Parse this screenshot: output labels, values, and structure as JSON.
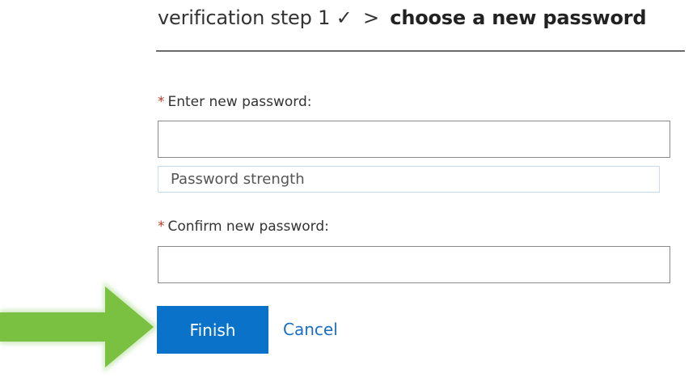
{
  "header": {
    "step_done": "verification step 1",
    "check_mark": "✓",
    "separator": ">",
    "current_step": "choose a new password"
  },
  "form": {
    "new_password": {
      "required_marker": "*",
      "label": "Enter new password:",
      "value": ""
    },
    "strength": {
      "label": "Password strength"
    },
    "confirm_password": {
      "required_marker": "*",
      "label": "Confirm new password:",
      "value": ""
    }
  },
  "actions": {
    "finish_label": "Finish",
    "cancel_label": "Cancel"
  },
  "colors": {
    "accent": "#0a73c9",
    "link": "#1a6fc2",
    "arrow": "#7ac142",
    "required": "#c0392b"
  },
  "icons": {
    "pointer": "green-arrow-icon"
  }
}
